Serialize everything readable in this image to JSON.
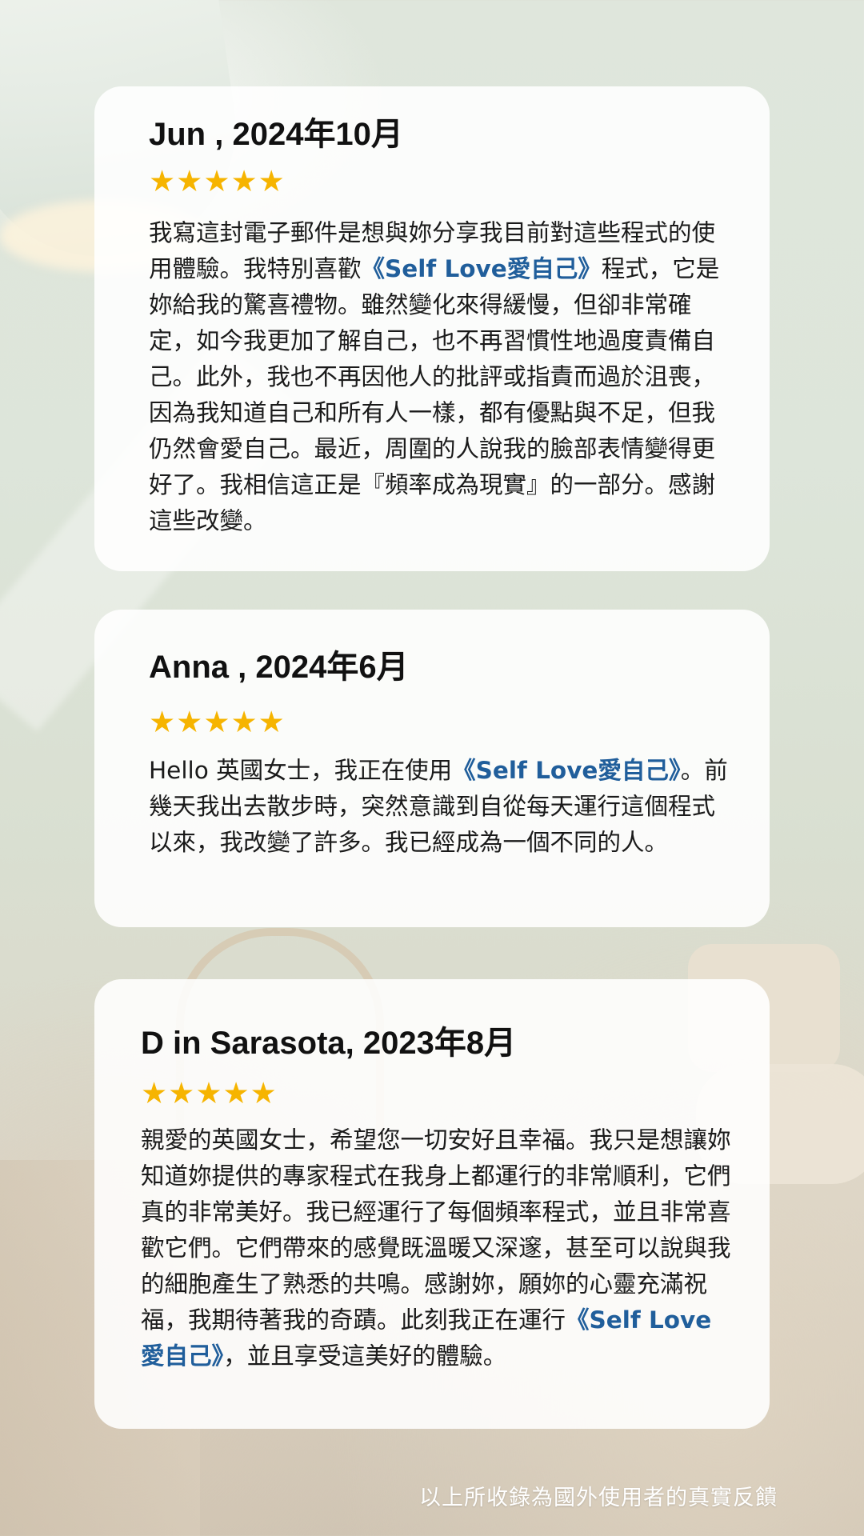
{
  "reviews": [
    {
      "reviewer": "Jun , 2024年10月",
      "stars": "★★★★★",
      "text_before": "我寫這封電子郵件是想與妳分享我目前對這些程式的使用體驗。我特別喜歡",
      "highlight": "《Self Love愛自己》",
      "text_after": "程式，它是妳給我的驚喜禮物。雖然變化來得緩慢，但卻非常確定，如今我更加了解自己，也不再習慣性地過度責備自己。此外，我也不再因他人的批評或指責而過於沮喪，因為我知道自己和所有人一樣，都有優點與不足，但我仍然會愛自己。最近，周圍的人說我的臉部表情變得更好了。我相信這正是『頻率成為現實』的一部分。感謝這些改變。"
    },
    {
      "reviewer": "Anna , 2024年6月",
      "stars": "★★★★★",
      "text_before": "Hello 英國女士，我正在使用",
      "highlight": "《Self Love愛自己》",
      "text_after": "。前幾天我出去散步時，突然意識到自從每天運行這個程式以來，我改變了許多。我已經成為一個不同的人。"
    },
    {
      "reviewer": "D in Sarasota, 2023年8月",
      "stars": "★★★★★",
      "text_before": "親愛的英國女士，希望您一切安好且幸福。我只是想讓妳知道妳提供的專家程式在我身上都運行的非常順利，它們真的非常美好。我已經運行了每個頻率程式，並且非常喜歡它們。它們帶來的感覺既溫暖又深邃，甚至可以說與我的細胞產生了熟悉的共鳴。感謝妳，願妳的心靈充滿祝福，我期待著我的奇蹟。此刻我正在運行",
      "highlight": "《Self Love愛自己》",
      "text_after": "，並且享受這美好的體驗。"
    }
  ],
  "footer": "以上所收錄為國外使用者的真實反饋",
  "colors": {
    "star": "#f6b400",
    "highlight": "#205e9b",
    "card_background": "#ffffff"
  }
}
